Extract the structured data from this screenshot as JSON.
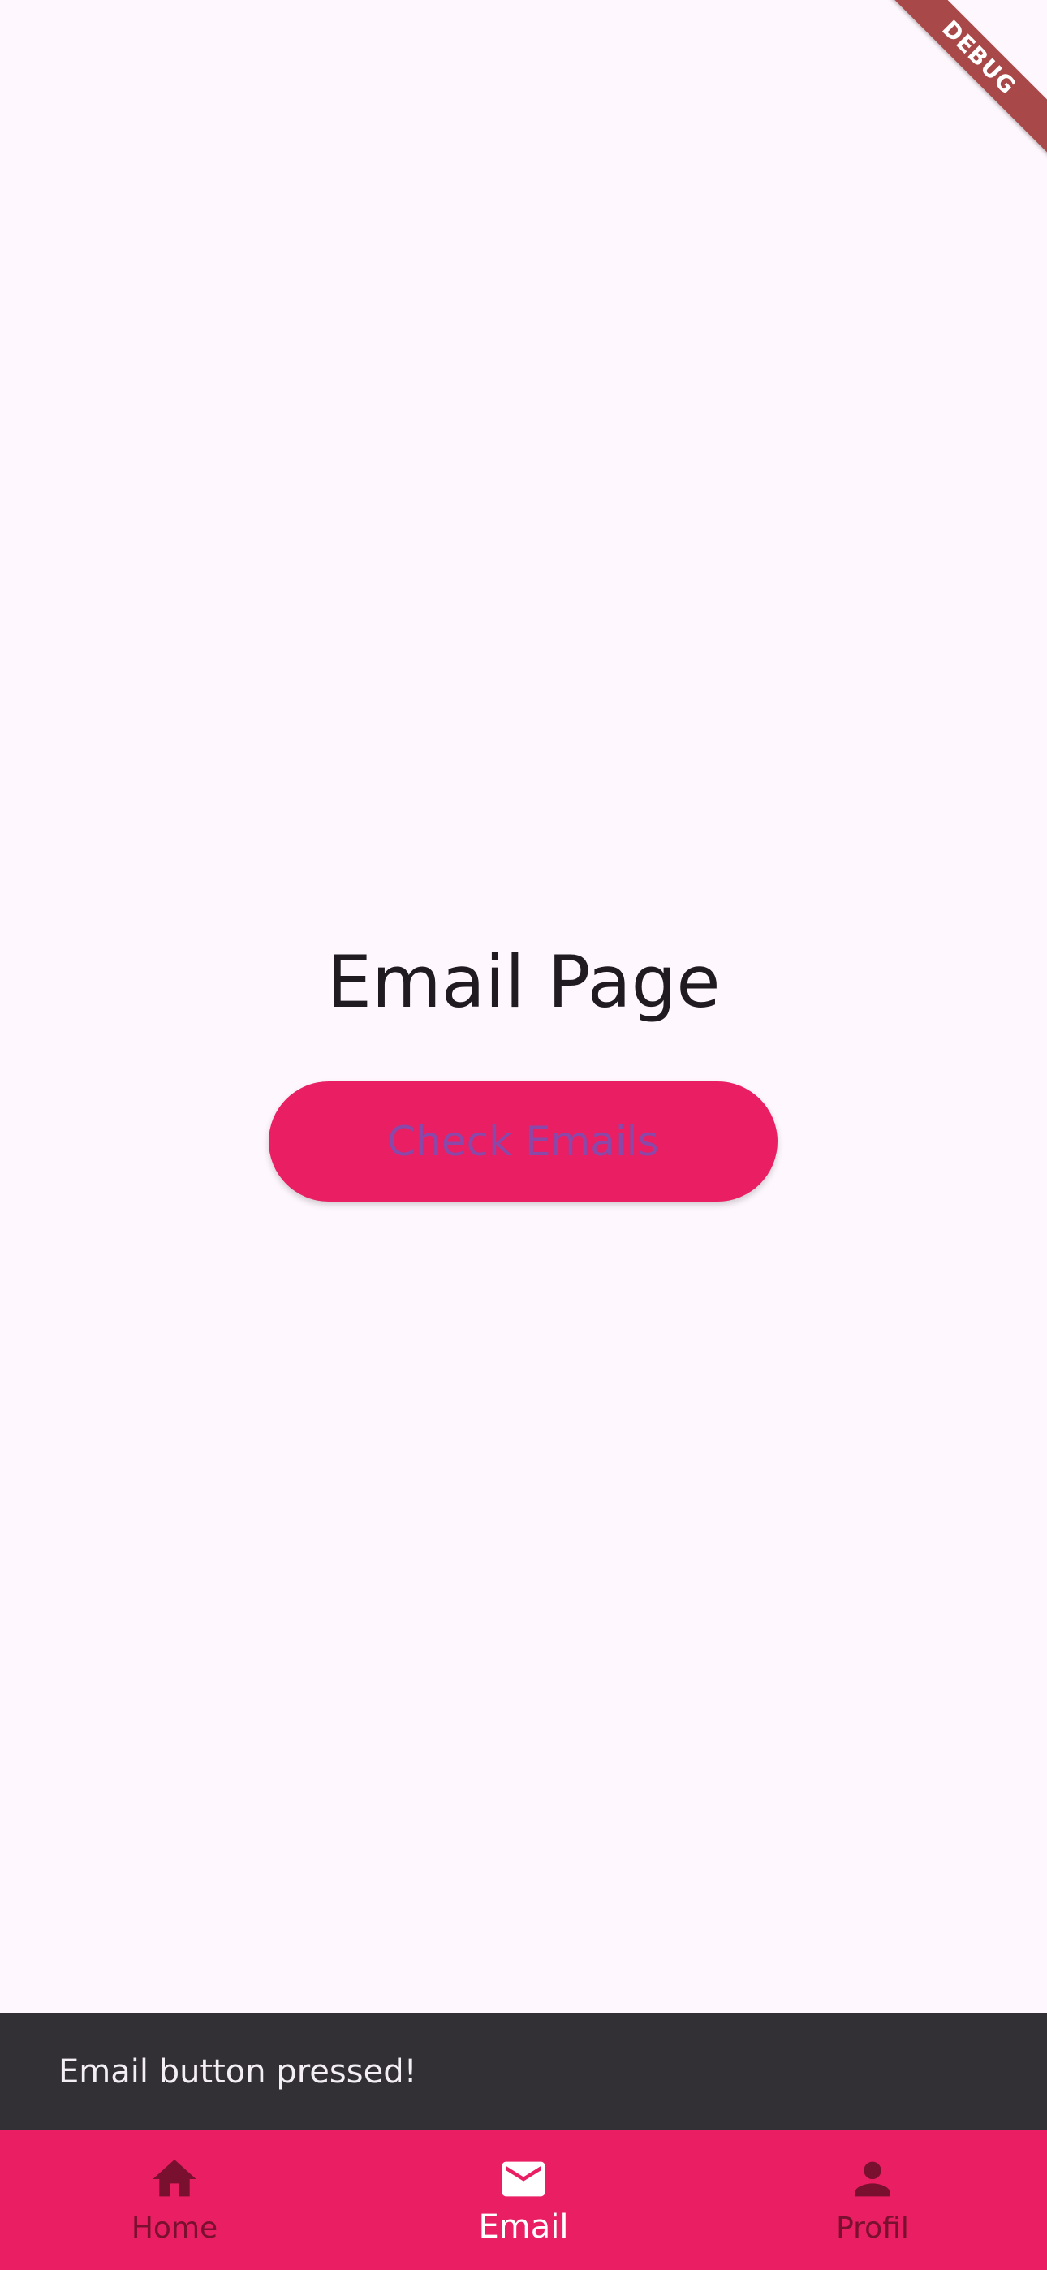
{
  "debug_banner": {
    "label": "DEBUG"
  },
  "main": {
    "title": "Email Page",
    "check_button_label": "Check Emails"
  },
  "snackbar": {
    "message": "Email button pressed!"
  },
  "bottom_nav": {
    "items": [
      {
        "label": "Home",
        "icon": "home-icon",
        "active": false
      },
      {
        "label": "Email",
        "icon": "mail-icon",
        "active": true
      },
      {
        "label": "Profil",
        "icon": "person-icon",
        "active": false
      }
    ]
  },
  "colors": {
    "background": "#fef7fd",
    "accent": "#e91e63",
    "snackbar": "#322f35",
    "debug_banner": "#a84848"
  }
}
